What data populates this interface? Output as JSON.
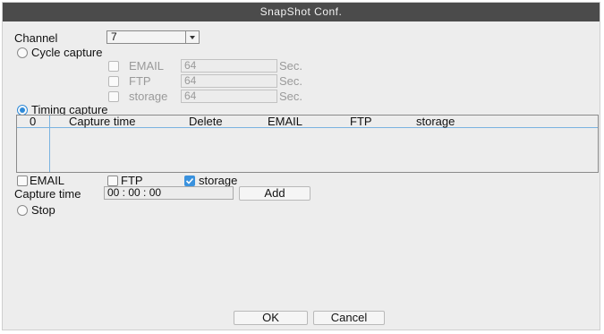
{
  "title": "SnapShot Conf.",
  "channel": {
    "label": "Channel",
    "value": "7"
  },
  "cycle": {
    "label": "Cycle capture",
    "items": [
      {
        "label": "EMAIL",
        "value": "64",
        "unit": "Sec."
      },
      {
        "label": "FTP",
        "value": "64",
        "unit": "Sec."
      },
      {
        "label": "storage",
        "value": "64",
        "unit": "Sec."
      }
    ]
  },
  "timing": {
    "label": "Timing capture",
    "columns": [
      "0",
      "Capture time",
      "Delete",
      "EMAIL",
      "FTP",
      "storage"
    ]
  },
  "options": {
    "email": "EMAIL",
    "ftp": "FTP",
    "storage": "storage"
  },
  "capture_time": {
    "label": "Capture time",
    "value": "00 : 00 : 00",
    "add": "Add"
  },
  "stop": {
    "label": "Stop"
  },
  "buttons": {
    "ok": "OK",
    "cancel": "Cancel"
  }
}
